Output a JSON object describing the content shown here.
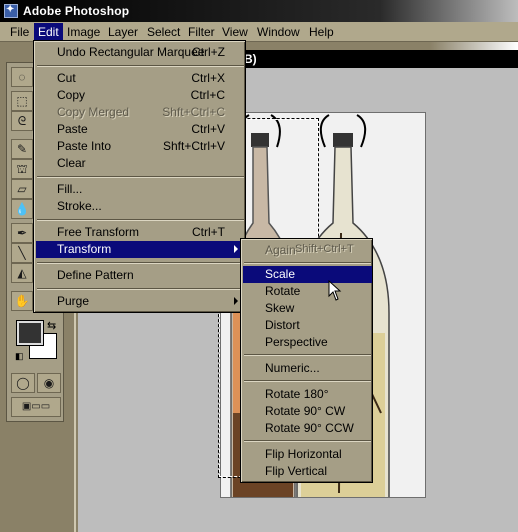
{
  "window": {
    "title": "Adobe Photoshop"
  },
  "menubar": {
    "items": [
      {
        "label": "File"
      },
      {
        "label": "Edit"
      },
      {
        "label": "Image"
      },
      {
        "label": "Layer"
      },
      {
        "label": "Select"
      },
      {
        "label": "Filter"
      },
      {
        "label": "View"
      },
      {
        "label": "Window"
      },
      {
        "label": "Help"
      }
    ]
  },
  "document": {
    "title_fragment": "B)"
  },
  "edit_menu": {
    "items": [
      {
        "label": "Undo Rectangular Marquee",
        "shortcut": "Ctrl+Z",
        "enabled": true
      },
      {
        "label": "Cut",
        "shortcut": "Ctrl+X",
        "enabled": true
      },
      {
        "label": "Copy",
        "shortcut": "Ctrl+C",
        "enabled": true
      },
      {
        "label": "Copy Merged",
        "shortcut": "Shft+Ctrl+C",
        "enabled": false
      },
      {
        "label": "Paste",
        "shortcut": "Ctrl+V",
        "enabled": true
      },
      {
        "label": "Paste Into",
        "shortcut": "Shft+Ctrl+V",
        "enabled": true
      },
      {
        "label": "Clear",
        "shortcut": "",
        "enabled": true
      },
      {
        "label": "Fill...",
        "shortcut": "",
        "enabled": true
      },
      {
        "label": "Stroke...",
        "shortcut": "",
        "enabled": true
      },
      {
        "label": "Free Transform",
        "shortcut": "Ctrl+T",
        "enabled": true
      },
      {
        "label": "Transform",
        "shortcut": "",
        "enabled": true,
        "highlighted": true,
        "submenu": true
      },
      {
        "label": "Define Pattern",
        "shortcut": "",
        "enabled": true
      },
      {
        "label": "Purge",
        "shortcut": "",
        "enabled": true,
        "submenu": true
      }
    ]
  },
  "transform_menu": {
    "items": [
      {
        "label": "Again",
        "shortcut": "Shift+Ctrl+T",
        "enabled": false
      },
      {
        "label": "Scale",
        "enabled": true,
        "highlighted": true
      },
      {
        "label": "Rotate",
        "enabled": true
      },
      {
        "label": "Skew",
        "enabled": true
      },
      {
        "label": "Distort",
        "enabled": true
      },
      {
        "label": "Perspective",
        "enabled": true
      },
      {
        "label": "Numeric...",
        "enabled": true
      },
      {
        "label": "Rotate 180°",
        "enabled": true
      },
      {
        "label": "Rotate 90° CW",
        "enabled": true
      },
      {
        "label": "Rotate 90° CCW",
        "enabled": true
      },
      {
        "label": "Flip Horizontal",
        "enabled": true
      },
      {
        "label": "Flip Vertical",
        "enabled": true
      }
    ]
  },
  "colors": {
    "menu_highlight": "#0a0a7a",
    "menu_bg": "#a59e86",
    "workspace": "#8a8167",
    "canvas_bg": "#bdbdbd",
    "foreground_swatch": "#333333",
    "background_swatch": "#ffffff"
  },
  "icons": {
    "app": "photoshop-icon",
    "tools": [
      "lasso-icon",
      "marquee-icon",
      "crop-icon",
      "move-icon",
      "pencil-icon",
      "eyedropper-icon",
      "stamp-icon",
      "smudge-icon",
      "eraser-icon",
      "blur-icon",
      "dodge-icon",
      "pen-icon",
      "type-icon",
      "line-icon",
      "gradient-icon",
      "bucket-icon",
      "hand-icon",
      "zoom-icon"
    ]
  }
}
